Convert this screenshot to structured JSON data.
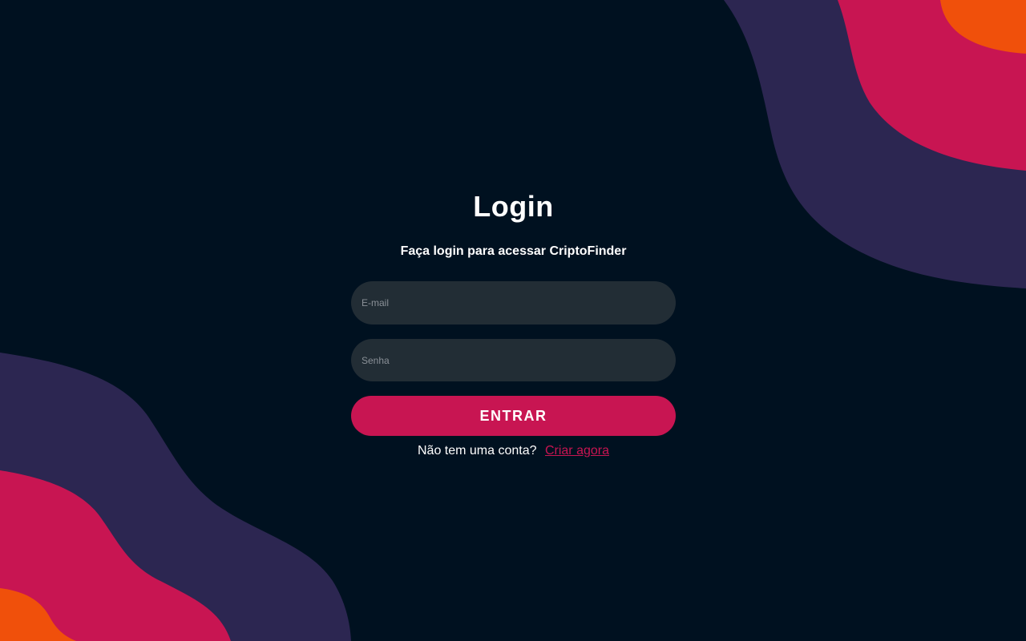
{
  "login": {
    "title": "Login",
    "subtitle": "Faça login para acessar CriptoFinder",
    "email_placeholder": "E-mail",
    "password_placeholder": "Senha",
    "submit_label": "ENTRAR",
    "signup_prompt": "Não tem uma conta?",
    "signup_link": "Criar agora"
  },
  "colors": {
    "background": "#001120",
    "input_background": "#222d35",
    "accent": "#c81552",
    "wave_purple": "#2c2651",
    "wave_pink": "#c81552",
    "wave_orange": "#f0500b"
  }
}
